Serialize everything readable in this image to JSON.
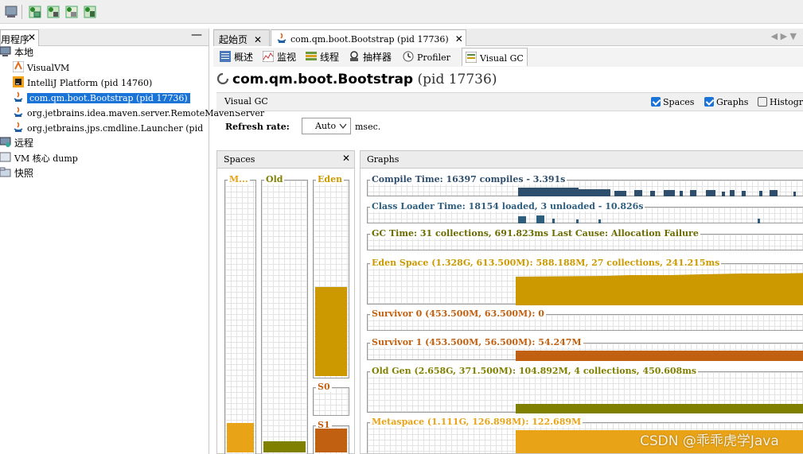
{
  "toolbar": {
    "buttons": [
      "snapshot-icon",
      "add-jmx-icon",
      "add-heap-dump-icon",
      "add-snapshot-icon",
      "compare-icon"
    ]
  },
  "left_panel": {
    "tab_label": "用程序",
    "tab_close": "✕",
    "minimize": "—",
    "tree": [
      {
        "label": "本地",
        "icon": "computer-icon"
      },
      {
        "label": "VisualVM",
        "icon": "visualvm-icon"
      },
      {
        "label": "IntelliJ Platform (pid 14760)",
        "icon": "intellij-icon"
      },
      {
        "label": "com.qm.boot.Bootstrap (pid 17736)",
        "icon": "java-icon",
        "selected": true
      },
      {
        "label": "org.jetbrains.idea.maven.server.RemoteMavenServer",
        "icon": "java-icon"
      },
      {
        "label": "org.jetbrains.jps.cmdline.Launcher (pid",
        "icon": "java-icon"
      },
      {
        "label": "远程",
        "icon": "network-icon"
      },
      {
        "label": "VM 核心 dump",
        "icon": "core-dump-icon"
      },
      {
        "label": "快照",
        "icon": "snapshot-folder-icon"
      }
    ]
  },
  "doc_tabs": [
    {
      "label": "起始页",
      "close": "✕"
    },
    {
      "label": "com.qm.boot.Bootstrap (pid 17736)",
      "close": "✕"
    }
  ],
  "nav_arrows": "◀ ▶ ▼",
  "sub_tabs": [
    {
      "label": "概述",
      "icon": "overview-icon"
    },
    {
      "label": "监视",
      "icon": "monitor-icon"
    },
    {
      "label": "线程",
      "icon": "threads-icon"
    },
    {
      "label": "抽样器",
      "icon": "sampler-icon"
    },
    {
      "label": "Profiler",
      "icon": "profiler-icon"
    },
    {
      "label": "Visual GC",
      "icon": "visualgc-icon"
    }
  ],
  "header": {
    "title": "com.qm.boot.Bootstrap",
    "pid": "(pid 17736)"
  },
  "visual_gc_bar": {
    "title": "Visual GC",
    "spaces": {
      "label": "Spaces",
      "checked": true
    },
    "graphs": {
      "label": "Graphs",
      "checked": true
    },
    "histogram": {
      "label": "Histogr",
      "checked": false
    }
  },
  "refresh": {
    "label": "Refresh rate:",
    "value": "Auto",
    "unit": "msec."
  },
  "spaces_panel": {
    "title": "Spaces",
    "close": "✕",
    "columns": [
      {
        "label": "M...",
        "color": "#e8a317",
        "fill": 0.11
      },
      {
        "label": "Old",
        "color": "#808000",
        "fill": 0.04
      },
      {
        "label": "Eden",
        "color": "#cc9900",
        "fill": 0.46
      },
      {
        "label": "S0",
        "color": "#c06010",
        "fill": 0.0
      },
      {
        "label": "S1",
        "color": "#c06010",
        "fill": 0.97
      }
    ]
  },
  "graphs_panel": {
    "title": "Graphs",
    "graphs": [
      {
        "label": "Compile Time: 16397 compiles - 3.391s",
        "color": "#2e4e6e"
      },
      {
        "label": "Class Loader Time: 18154 loaded, 3 unloaded - 10.826s",
        "color": "#2e5e7e"
      },
      {
        "label": "GC Time: 31 collections, 691.823ms Last Cause: Allocation Failure",
        "color": "#6b6b00"
      },
      {
        "label": "Eden Space (1.328G, 613.500M): 588.188M, 27 collections, 241.215ms",
        "color": "#cc9900"
      },
      {
        "label": "Survivor 0 (453.500M, 63.500M): 0",
        "color": "#c06010"
      },
      {
        "label": "Survivor 1 (453.500M, 56.500M): 54.247M",
        "color": "#c06010"
      },
      {
        "label": "Old Gen (2.658G, 371.500M): 104.892M, 4 collections, 450.608ms",
        "color": "#808000"
      },
      {
        "label": "Metaspace (1.111G, 126.898M): 122.689M",
        "color": "#e8a317"
      }
    ]
  },
  "watermark": "CSDN @乖乖虎学Java"
}
